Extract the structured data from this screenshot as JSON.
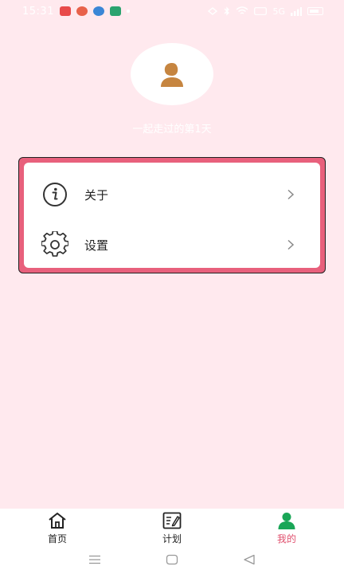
{
  "status_bar": {
    "time": "15:31",
    "app_icon_colors": [
      "#e84a4a",
      "#e8614a",
      "#3a86d6",
      "#2ba36f"
    ],
    "signal_text": "5G"
  },
  "profile": {
    "avatar_icon": "person-icon",
    "avatar_color": "#c68540",
    "days_text": "一起走过的第1天"
  },
  "menu": {
    "items": [
      {
        "label": "关于",
        "icon": "info-icon"
      },
      {
        "label": "设置",
        "icon": "gear-icon"
      }
    ],
    "accent": "#e8607c"
  },
  "bottom_nav": {
    "items": [
      {
        "label": "首页",
        "icon": "home-icon"
      },
      {
        "label": "计划",
        "icon": "plan-edit-icon"
      },
      {
        "label": "我的",
        "icon": "person-icon",
        "active": true
      }
    ],
    "active_color": "#1aa657",
    "active_label_color": "#e0506e"
  }
}
